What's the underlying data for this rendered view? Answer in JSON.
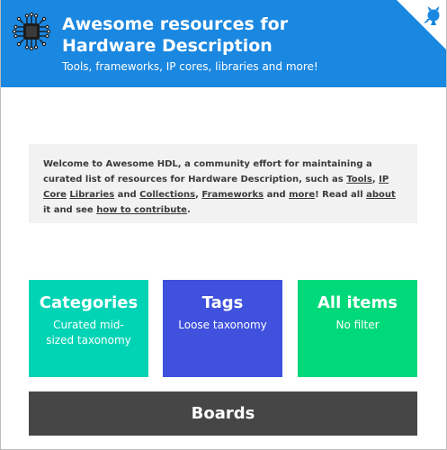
{
  "header": {
    "title": "Awesome resources for Hardware Description",
    "subtitle": "Tools, frameworks, IP cores, libraries and more!",
    "logo_icon": "chip-icon",
    "corner_icon": "github-octocat-icon",
    "bg_color": "#1a87e0"
  },
  "welcome": {
    "t1": "Welcome to Awesome HDL, a community effort for maintaining a curated list of resources for Hardware Description, such as ",
    "link_tools": "Tools",
    "t2": ", ",
    "link_ipcore": "IP Core",
    "t3": " ",
    "link_libraries": "Libraries",
    "t4": " and ",
    "link_collections": "Collections",
    "t5": ", ",
    "link_frameworks": "Frameworks",
    "t6": " and ",
    "link_more": "more",
    "t7": "! Read all ",
    "link_about": "about",
    "t8": " it and see ",
    "link_how": "how to contribute",
    "t9": "."
  },
  "cards": [
    {
      "title": "Categories",
      "subtitle": "Curated mid-sized taxonomy",
      "color": "#00d4b5"
    },
    {
      "title": "Tags",
      "subtitle": "Loose taxonomy",
      "color": "#3f51dd"
    },
    {
      "title": "All items",
      "subtitle": "No filter",
      "color": "#00d97a"
    }
  ],
  "boards": {
    "label": "Boards",
    "color": "#464646"
  }
}
